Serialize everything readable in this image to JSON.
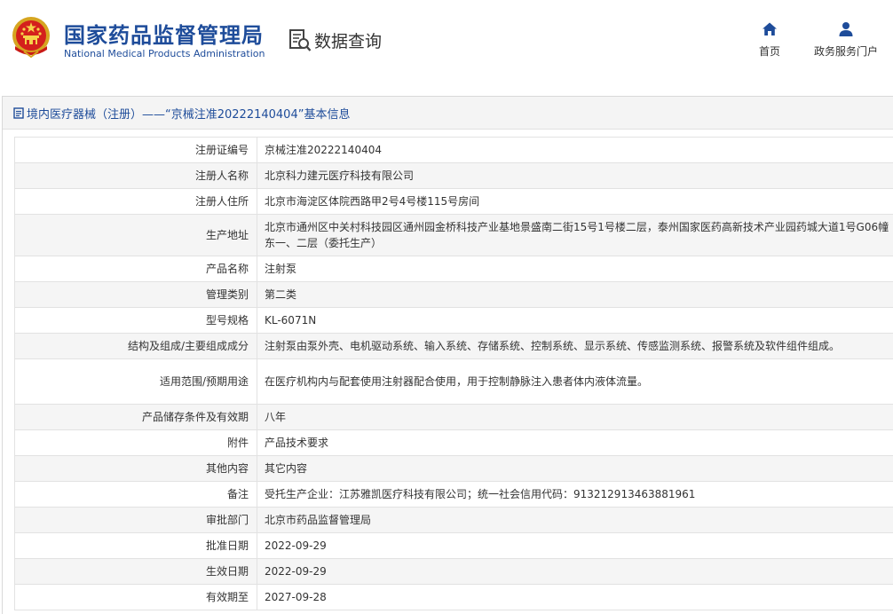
{
  "header": {
    "org_name_cn": "国家药品监督管理局",
    "org_name_en": "National Medical Products Administration",
    "section_label": "数据查询",
    "nav": [
      {
        "label": "首页",
        "icon": "home-icon"
      },
      {
        "label": "政务服务门户",
        "icon": "user-icon"
      }
    ]
  },
  "panel": {
    "title": "境内医疗器械（注册）——“京械注准20222140404”基本信息"
  },
  "rows": [
    {
      "label": "注册证编号",
      "value": "京械注准20222140404"
    },
    {
      "label": "注册人名称",
      "value": "北京科力建元医疗科技有限公司"
    },
    {
      "label": "注册人住所",
      "value": "北京市海淀区体院西路甲2号4号楼115号房间"
    },
    {
      "label": "生产地址",
      "value": "北京市通州区中关村科技园区通州园金桥科技产业基地景盛南二街15号1号楼二层，泰州国家医药高新技术产业园药城大道1号G06幢东一、二层（委托生产）"
    },
    {
      "label": "产品名称",
      "value": "注射泵"
    },
    {
      "label": "管理类别",
      "value": "第二类"
    },
    {
      "label": "型号规格",
      "value": "KL-6071N"
    },
    {
      "label": "结构及组成/主要组成成分",
      "value": "注射泵由泵外壳、电机驱动系统、输入系统、存储系统、控制系统、显示系统、传感监测系统、报警系统及软件组件组成。"
    },
    {
      "label": "适用范围/预期用途",
      "value": "在医疗机构内与配套使用注射器配合使用，用于控制静脉注入患者体内液体流量。"
    },
    {
      "label": "产品储存条件及有效期",
      "value": "八年"
    },
    {
      "label": "附件",
      "value": "产品技术要求"
    },
    {
      "label": "其他内容",
      "value": "其它内容"
    },
    {
      "label": "备注",
      "value": "受托生产企业：江苏雅凯医疗科技有限公司；统一社会信用代码：913212913463881961"
    },
    {
      "label": "审批部门",
      "value": "北京市药品监督管理局"
    },
    {
      "label": "批准日期",
      "value": "2022-09-29"
    },
    {
      "label": "生效日期",
      "value": "2022-09-29"
    },
    {
      "label": "有效期至",
      "value": "2027-09-28"
    }
  ]
}
